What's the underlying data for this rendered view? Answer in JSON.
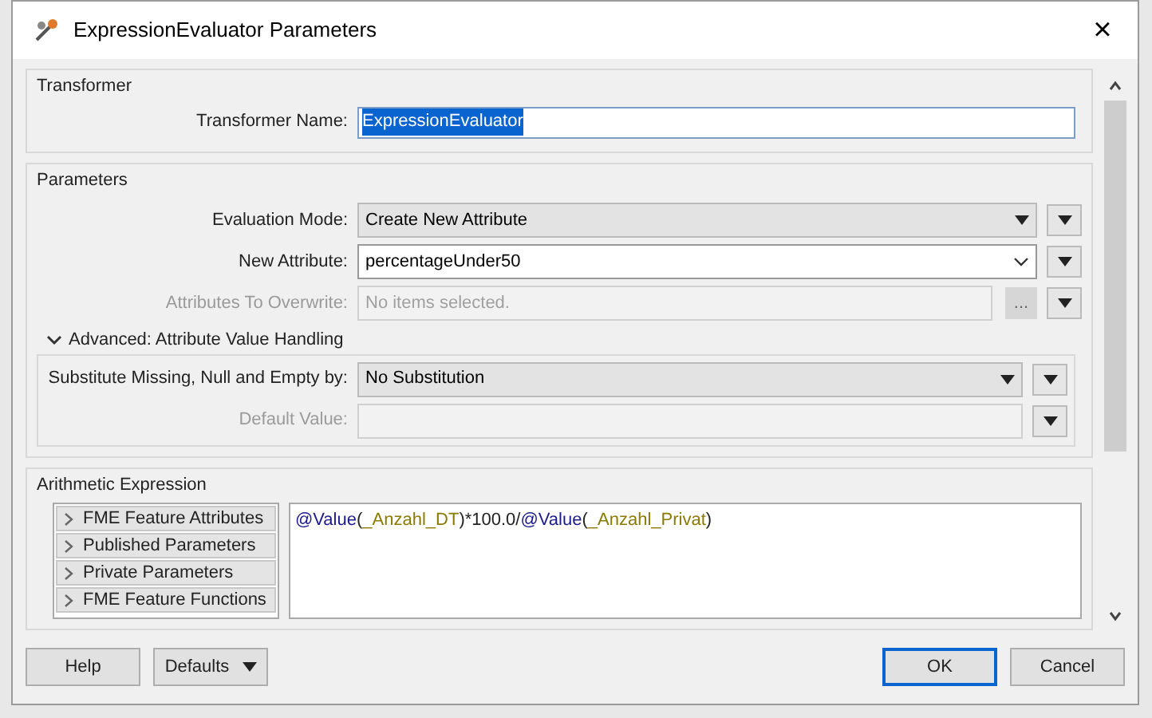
{
  "window": {
    "title": "ExpressionEvaluator Parameters",
    "close": "×"
  },
  "transformer": {
    "title": "Transformer",
    "fields": [
      {
        "label": "Transformer Name:",
        "value": "ExpressionEvaluator",
        "selected": true
      }
    ]
  },
  "parameters": {
    "title": "Parameters",
    "fields": [
      {
        "label": "Evaluation Mode:",
        "kind": "dropdown",
        "value": "Create New Attribute",
        "disabled": false
      },
      {
        "label": "New Attribute:",
        "kind": "combo",
        "value": "percentageUnder50",
        "disabled": false
      },
      {
        "label": "Attributes To Overwrite:",
        "kind": "picker",
        "placeholder": "No items selected.",
        "disabled": true,
        "button": "..."
      }
    ]
  },
  "advanced": {
    "title": "Advanced: Attribute Value Handling",
    "expanded": true,
    "fields": [
      {
        "label": "Substitute Missing, Null and Empty by:",
        "kind": "dropdown",
        "value": "No Substitution",
        "disabled": false
      },
      {
        "label": "Default Value:",
        "kind": "text",
        "disabled": true
      }
    ]
  },
  "arithmetic": {
    "title": "Arithmetic Expression",
    "categories": [
      {
        "label": "FME Feature Attributes",
        "expanded": false
      },
      {
        "label": "Published Parameters",
        "expanded": false
      },
      {
        "label": "Private Parameters",
        "expanded": false
      },
      {
        "label": "FME Feature Functions",
        "expanded": false
      }
    ],
    "expression": [
      {
        "text": "@Value",
        "kind": "function"
      },
      {
        "text": "(",
        "kind": "plain"
      },
      {
        "text": "_Anzahl_DT",
        "kind": "attribute"
      },
      {
        "text": ")*100.0/",
        "kind": "plain"
      },
      {
        "text": "@Value",
        "kind": "function"
      },
      {
        "text": "(",
        "kind": "plain"
      },
      {
        "text": "_Anzahl_Privat",
        "kind": "attribute"
      },
      {
        "text": ")",
        "kind": "plain"
      }
    ]
  },
  "buttons": {
    "left": [
      {
        "label": "Help",
        "kind": "plain"
      },
      {
        "label": "Defaults",
        "kind": "menu"
      }
    ],
    "right": [
      {
        "label": "OK",
        "kind": "default"
      },
      {
        "label": "Cancel",
        "kind": "plain"
      }
    ]
  }
}
